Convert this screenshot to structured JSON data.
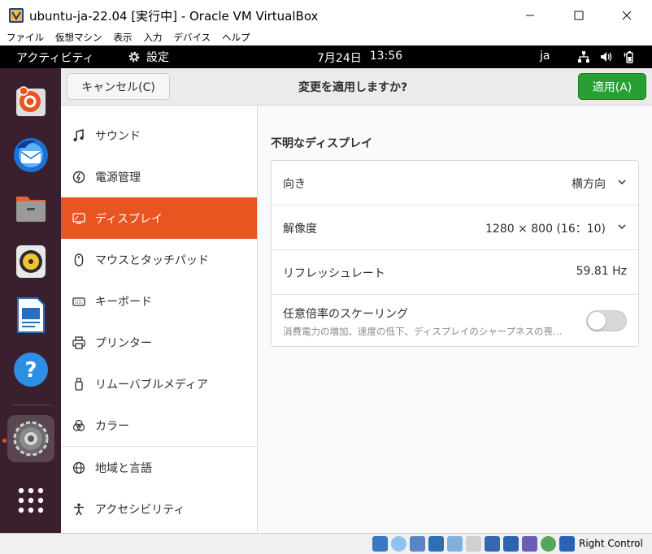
{
  "window": {
    "title": "ubuntu-ja-22.04 [実行中] - Oracle VM VirtualBox",
    "minimize": "—",
    "maximize": "☐",
    "close": "✕"
  },
  "host_menu": [
    "ファイル",
    "仮想マシン",
    "表示",
    "入力",
    "デバイス",
    "ヘルプ"
  ],
  "topbar": {
    "activities": "アクティビティ",
    "app": "設定",
    "date": "7月24日",
    "time": "13:56",
    "lang": "ja"
  },
  "header": {
    "cancel": "キャンセル(C)",
    "title": "変更を適用しますか?",
    "apply": "適用(A)"
  },
  "sidebar": {
    "items": [
      {
        "label": "サウンド",
        "icon": "music-note-icon"
      },
      {
        "label": "電源管理",
        "icon": "power-icon"
      },
      {
        "label": "ディスプレイ",
        "icon": "display-icon"
      },
      {
        "label": "マウスとタッチパッド",
        "icon": "mouse-icon"
      },
      {
        "label": "キーボード",
        "icon": "keyboard-icon"
      },
      {
        "label": "プリンター",
        "icon": "printer-icon"
      },
      {
        "label": "リムーバブルメディア",
        "icon": "usb-drive-icon"
      },
      {
        "label": "カラー",
        "icon": "color-icon"
      },
      {
        "label": "地域と言語",
        "icon": "globe-icon"
      },
      {
        "label": "アクセシビリティ",
        "icon": "accessibility-icon"
      }
    ],
    "selected_index": 2
  },
  "display": {
    "section_title": "不明なディスプレイ",
    "orientation_label": "向き",
    "orientation_value": "横方向",
    "resolution_label": "解像度",
    "resolution_value": "1280 × 800 (16：10)",
    "refresh_label": "リフレッシュレート",
    "refresh_value": "59.81 Hz",
    "scaling_label": "任意倍率のスケーリング",
    "scaling_desc": "消費電力の増加、速度の低下、ディスプレイのシャープネスの喪…",
    "scaling_enabled": false
  },
  "statusbar": {
    "host_key": "Right Control"
  },
  "colors": {
    "accent": "#e95420",
    "apply": "#26a033",
    "dock": "#3a1f2e"
  }
}
